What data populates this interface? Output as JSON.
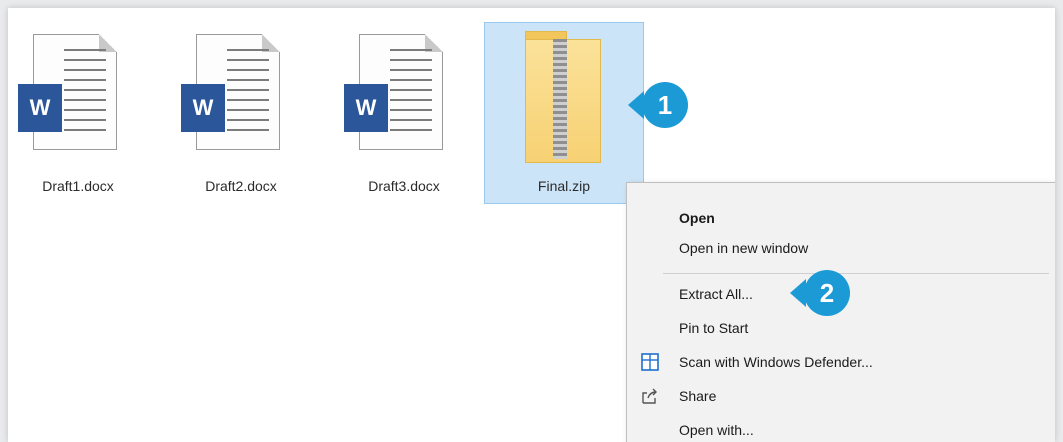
{
  "files": [
    {
      "name": "Draft1.docx",
      "type": "word",
      "icon_letter": "W"
    },
    {
      "name": "Draft2.docx",
      "type": "word",
      "icon_letter": "W"
    },
    {
      "name": "Draft3.docx",
      "type": "word",
      "icon_letter": "W"
    },
    {
      "name": "Final.zip",
      "type": "zip",
      "selected": true
    }
  ],
  "callouts": {
    "first": "1",
    "second": "2"
  },
  "context_menu": {
    "items": [
      {
        "label": "Open",
        "bold": true
      },
      {
        "label": "Open in new window"
      },
      {
        "label": "Extract All..."
      },
      {
        "label": "Pin to Start"
      },
      {
        "label": "Scan with Windows Defender...",
        "icon": "windows-defender-icon"
      },
      {
        "label": "Share",
        "icon": "share-icon"
      },
      {
        "label": "Open with..."
      }
    ]
  },
  "colors": {
    "word_blue": "#2b579a",
    "selection_bg": "#cce4f7",
    "callout_blue": "#1b9ad6",
    "zip_yellow": "#f7d173"
  }
}
